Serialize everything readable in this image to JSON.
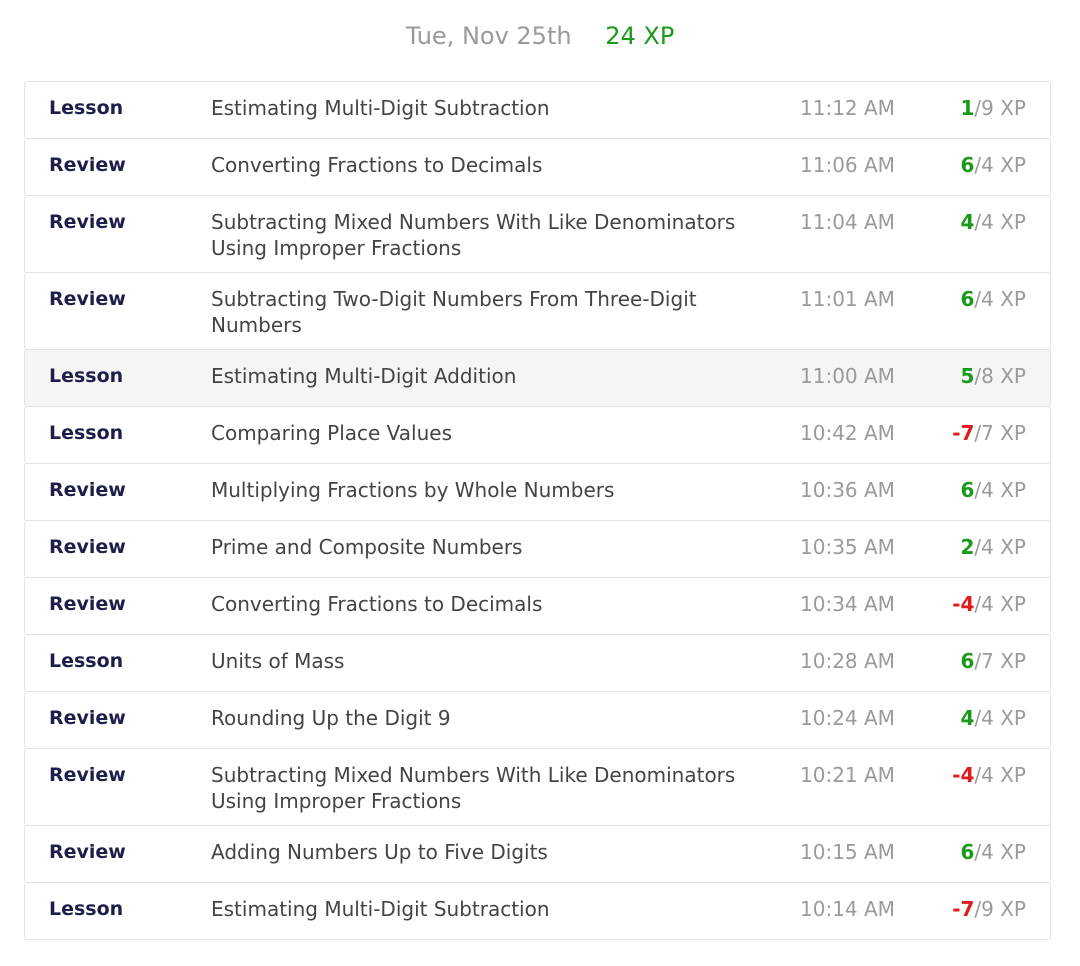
{
  "header": {
    "date": "Tue, Nov 25th",
    "total_xp": "24 XP"
  },
  "colors": {
    "positive": "#1a9a1a",
    "negative": "#e01b1b",
    "type_label": "#1d1f4a",
    "muted": "#9a9a9a"
  },
  "activities": [
    {
      "type": "Lesson",
      "title": "Estimating Multi-Digit Subtraction",
      "time": "11:12 AM",
      "earned": "1",
      "max": "/9 XP"
    },
    {
      "type": "Review",
      "title": "Converting Fractions to Decimals",
      "time": "11:06 AM",
      "earned": "6",
      "max": "/4 XP"
    },
    {
      "type": "Review",
      "title": "Subtracting Mixed Numbers With Like Denominators Using Improper Fractions",
      "time": "11:04 AM",
      "earned": "4",
      "max": "/4 XP"
    },
    {
      "type": "Review",
      "title": "Subtracting Two-Digit Numbers From Three-Digit Numbers",
      "time": "11:01 AM",
      "earned": "6",
      "max": "/4 XP"
    },
    {
      "type": "Lesson",
      "title": "Estimating Multi-Digit Addition",
      "time": "11:00 AM",
      "earned": "5",
      "max": "/8 XP"
    },
    {
      "type": "Lesson",
      "title": "Comparing Place Values",
      "time": "10:42 AM",
      "earned": "-7",
      "max": "/7 XP"
    },
    {
      "type": "Review",
      "title": "Multiplying Fractions by Whole Numbers",
      "time": "10:36 AM",
      "earned": "6",
      "max": "/4 XP"
    },
    {
      "type": "Review",
      "title": "Prime and Composite Numbers",
      "time": "10:35 AM",
      "earned": "2",
      "max": "/4 XP"
    },
    {
      "type": "Review",
      "title": "Converting Fractions to Decimals",
      "time": "10:34 AM",
      "earned": "-4",
      "max": "/4 XP"
    },
    {
      "type": "Lesson",
      "title": "Units of Mass",
      "time": "10:28 AM",
      "earned": "6",
      "max": "/7 XP"
    },
    {
      "type": "Review",
      "title": "Rounding Up the Digit 9",
      "time": "10:24 AM",
      "earned": "4",
      "max": "/4 XP"
    },
    {
      "type": "Review",
      "title": "Subtracting Mixed Numbers With Like Denominators Using Improper Fractions",
      "time": "10:21 AM",
      "earned": "-4",
      "max": "/4 XP"
    },
    {
      "type": "Review",
      "title": "Adding Numbers Up to Five Digits",
      "time": "10:15 AM",
      "earned": "6",
      "max": "/4 XP"
    },
    {
      "type": "Lesson",
      "title": "Estimating Multi-Digit Subtraction",
      "time": "10:14 AM",
      "earned": "-7",
      "max": "/9 XP"
    }
  ]
}
